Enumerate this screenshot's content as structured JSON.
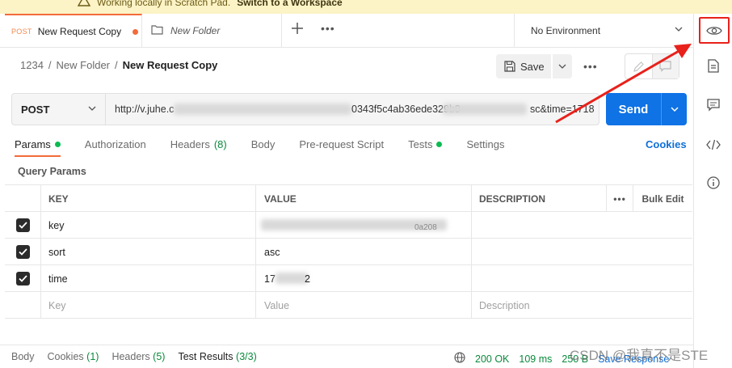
{
  "banner": {
    "text": "Working locally in Scratch Pad.",
    "link": "Switch to a Workspace"
  },
  "tabs": {
    "active": {
      "method": "POST",
      "title": "New Request Copy"
    },
    "folder": {
      "title": "New Folder"
    }
  },
  "environment": {
    "label": "No Environment"
  },
  "breadcrumb": {
    "workspace": "1234",
    "folder": "New Folder",
    "request": "New Request Copy",
    "separator": "/"
  },
  "toolbar": {
    "save_label": "Save"
  },
  "request": {
    "method": "POST",
    "url_start": "http://v.juhe.c",
    "url_mid": "0343f5c4ab36ede329b9",
    "url_end": "sc&time=1718"
  },
  "send": {
    "label": "Send"
  },
  "req_tabs": {
    "params": "Params",
    "authorization": "Authorization",
    "headers": "Headers",
    "headers_count": "(8)",
    "body": "Body",
    "prerequest": "Pre-request Script",
    "tests": "Tests",
    "settings": "Settings",
    "cookies": "Cookies"
  },
  "query_params": {
    "title": "Query Params",
    "columns": {
      "key": "KEY",
      "value": "VALUE",
      "description": "DESCRIPTION",
      "bulk_edit": "Bulk Edit"
    },
    "rows": [
      {
        "key": "key",
        "value_visible": "0a208"
      },
      {
        "key": "sort",
        "value": "asc"
      },
      {
        "key": "time",
        "value_start": "17",
        "value_end": "2"
      }
    ],
    "placeholder": {
      "key": "Key",
      "value": "Value",
      "description": "Description"
    }
  },
  "response": {
    "tabs": {
      "body": "Body",
      "cookies": "Cookies",
      "cookies_count": "(1)",
      "headers": "Headers",
      "headers_count": "(5)",
      "test_results": "Test Results",
      "test_count": "(3/3)"
    },
    "status": "200 OK",
    "time": "109 ms",
    "size": "250 B",
    "save_response": "Save Response"
  },
  "watermark": "CSDN @我真不是STE",
  "colors": {
    "accent_orange": "#f26b3a",
    "send_blue": "#0f72e5",
    "success_green": "#0cbb52",
    "annotation_red": "#e8211b"
  }
}
